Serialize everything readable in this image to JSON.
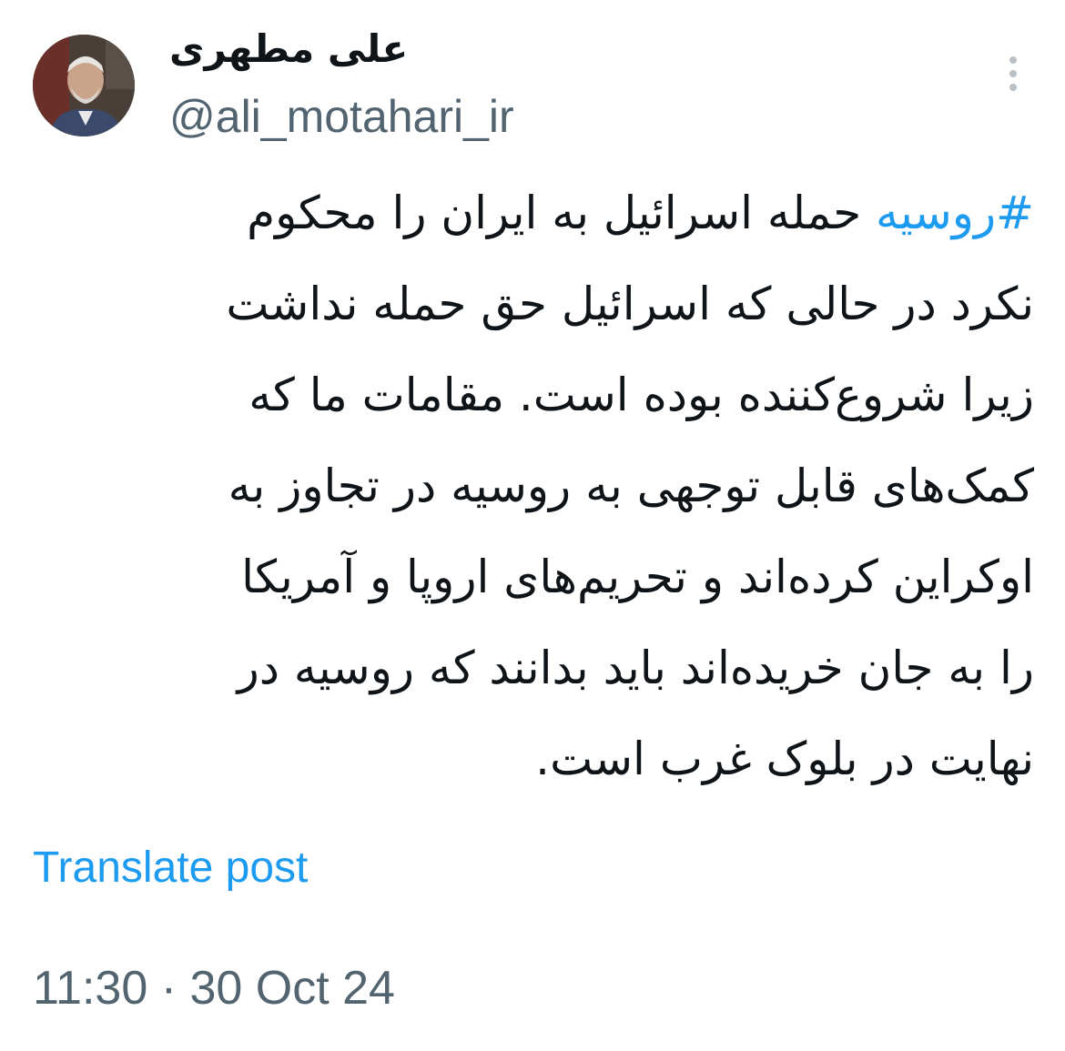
{
  "author": {
    "display_name": "علی مطهری",
    "handle": "@ali_motahari_ir"
  },
  "tweet": {
    "hashtag": "#روسیه",
    "lines": [
      " حمله اسرائیل به ایران را محکوم",
      "نکرد در حالی که اسرائیل حق حمله نداشت",
      "زیرا شروع‌کننده بوده است. مقامات ما که",
      "کمک‌های قابل توجهی به روسیه در تجاوز به",
      "اوکراین کرده‌اند و تحریم‌های اروپا و آمریکا",
      "را به جان خریده‌اند باید بدانند که روسیه در",
      "نهایت در بلوک غرب است."
    ]
  },
  "translate_label": "Translate post",
  "timestamp": "11:30 · 30 Oct 24",
  "icons": {
    "more": "more-vertical-icon",
    "avatar": "profile-photo"
  },
  "colors": {
    "link": "#1d9bf0",
    "secondary_text": "#536471",
    "primary_text": "#0f1419"
  }
}
